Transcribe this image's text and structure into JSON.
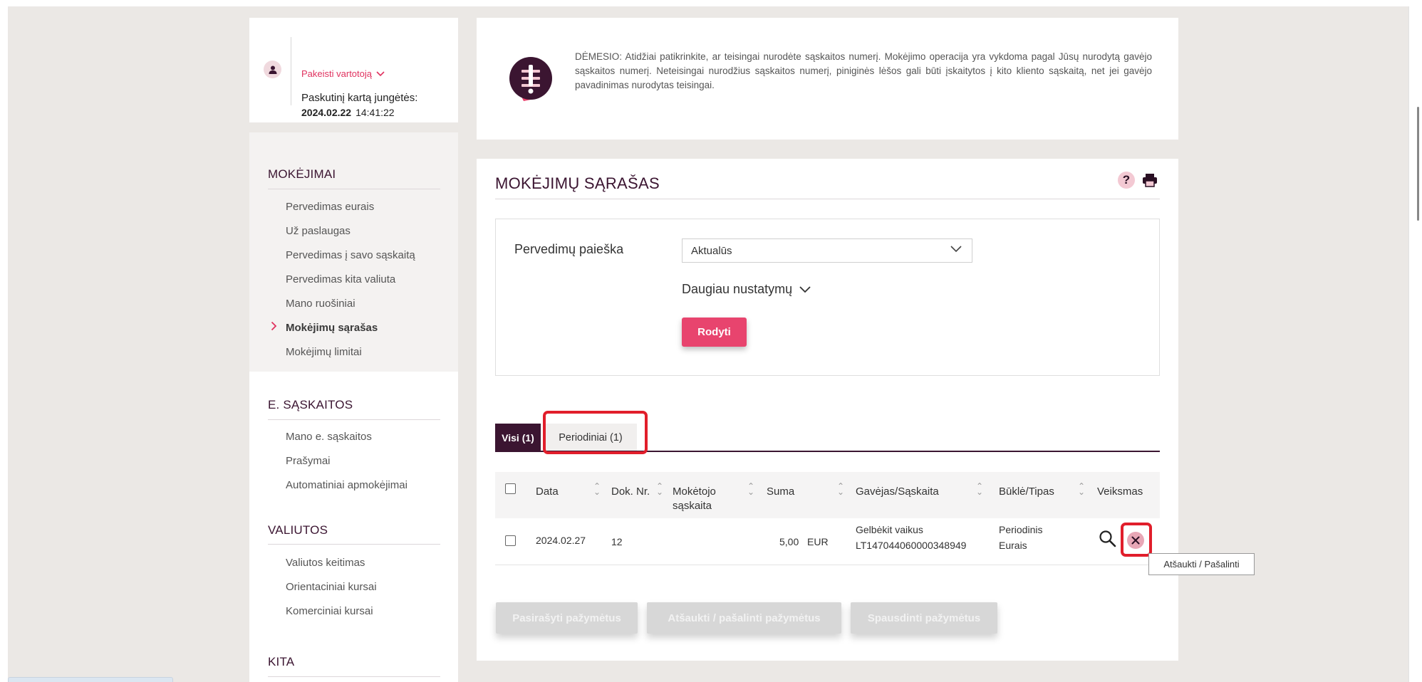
{
  "user": {
    "switch_label": "Pakeisti vartotoją",
    "last_login_label": "Paskutinį kartą jungėtės:",
    "last_login_date": "2024.02.22",
    "last_login_time": "14:41:22"
  },
  "notice": {
    "text": "DĖMESIO: Atidžiai patikrinkite, ar teisingai nurodėte sąskaitos numerį. Mokėjimo operacija yra vykdoma pagal Jūsų nurodytą gavėjo sąskaitos numerį. Neteisingai nurodžius sąskaitos numerį, piniginės lėšos gali būti įskaitytos į kito kliento sąskaitą, net jei gavėjo pavadinimas nurodytas teisingai."
  },
  "sidebar": {
    "payments_title": "MOKĖJIMAI",
    "payments_items": [
      "Pervedimas eurais",
      "Už paslaugas",
      "Pervedimas į savo sąskaitą",
      "Pervedimas kita valiuta",
      "Mano ruošiniai",
      "Mokėjimų sąrašas",
      "Mokėjimų limitai"
    ],
    "active_index": 5,
    "einvoice_title": "E. SĄSKAITOS",
    "einvoice_items": [
      "Mano e. sąskaitos",
      "Prašymai",
      "Automatiniai apmokėjimai"
    ],
    "currency_title": "VALIUTOS",
    "currency_items": [
      "Valiutos keitimas",
      "Orientaciniai kursai",
      "Komerciniai kursai"
    ],
    "other_title": "KITA"
  },
  "main": {
    "title": "MOKĖJIMŲ SĄRAŠAS",
    "filter": {
      "label": "Pervedimų paieška",
      "selected": "Aktualūs",
      "more_settings": "Daugiau nustatymų",
      "show_button": "Rodyti"
    },
    "tabs": [
      {
        "label": "Visi (1)",
        "active": true
      },
      {
        "label": "Periodiniai (1)",
        "active": false
      }
    ],
    "table": {
      "headers": [
        "Data",
        "Dok. Nr.",
        "Mokėtojo sąskaita",
        "Suma",
        "Gavėjas/Sąskaita",
        "Būklė/Tipas",
        "Veiksmas"
      ],
      "rows": [
        {
          "date": "2024.02.27",
          "doc_no": "12",
          "payer_account": "",
          "amount": "5,00",
          "currency": "EUR",
          "payee_name": "Gelbėkit vaikus",
          "payee_account": "LT147044060000348949",
          "status": "Periodinis",
          "type": "Eurais"
        }
      ]
    },
    "tooltip": "Atšaukti / Pašalinti",
    "bulk_buttons": [
      "Pasirašyti pažymėtus",
      "Atšaukti / pašalinti pažymėtus",
      "Spausdinti pažymėtus"
    ]
  },
  "colors": {
    "accent": "#e8446e",
    "brand_dark": "#3b1531",
    "highlight_outline": "#e11e2b"
  },
  "icons": {
    "user": "user-icon",
    "notice": "warning-document-icon",
    "help": "help-icon",
    "print": "print-icon",
    "search": "magnifier-icon",
    "cancel": "close-circle-icon"
  }
}
